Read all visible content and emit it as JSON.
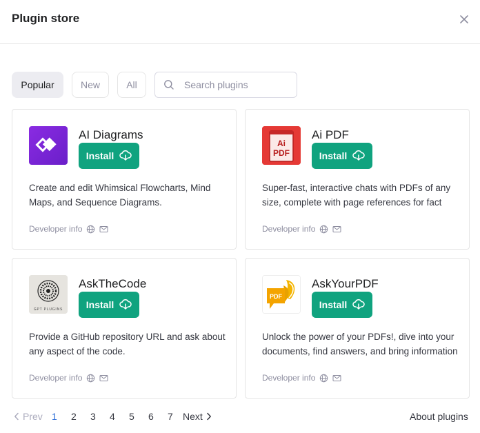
{
  "header": {
    "title": "Plugin store"
  },
  "tabs": [
    {
      "label": "Popular",
      "active": true
    },
    {
      "label": "New",
      "active": false
    },
    {
      "label": "All",
      "active": false
    }
  ],
  "search": {
    "placeholder": "Search plugins",
    "value": ""
  },
  "plugins": [
    {
      "name": "AI Diagrams",
      "install_label": "Install",
      "description": "Create and edit Whimsical Flowcharts, Mind Maps, and Sequence Diagrams.",
      "developer_label": "Developer info",
      "logo_icon": "whimsical-diamond-icon",
      "logo_color": "#7b2ff7"
    },
    {
      "name": "Ai PDF",
      "install_label": "Install",
      "description": "Super-fast, interactive chats with PDFs of any size, complete with page references for fact checking.",
      "developer_label": "Developer info",
      "logo_icon": "pdf-document-icon",
      "logo_color": "#d32f2f",
      "logo_text_top": "Ai",
      "logo_text_bottom": "PDF"
    },
    {
      "name": "AskTheCode",
      "install_label": "Install",
      "description": "Provide a GitHub repository URL and ask about any aspect of the code.",
      "developer_label": "Developer info",
      "logo_icon": "mandala-icon",
      "logo_caption": "GPT PLUGINS"
    },
    {
      "name": "AskYourPDF",
      "install_label": "Install",
      "description": "Unlock the power of your PDFs!, dive into your documents, find answers, and bring information to your fingertips.",
      "developer_label": "Developer info",
      "logo_icon": "pdf-feather-icon",
      "logo_color": "#f0a500",
      "logo_text": "PDF"
    }
  ],
  "pagination": {
    "prev_label": "Prev",
    "next_label": "Next",
    "pages": [
      "1",
      "2",
      "3",
      "4",
      "5",
      "6",
      "7"
    ],
    "current_page": "1"
  },
  "footer": {
    "about_label": "About plugins"
  },
  "colors": {
    "accent": "#10a37f",
    "current_page": "#2e6fd8"
  }
}
